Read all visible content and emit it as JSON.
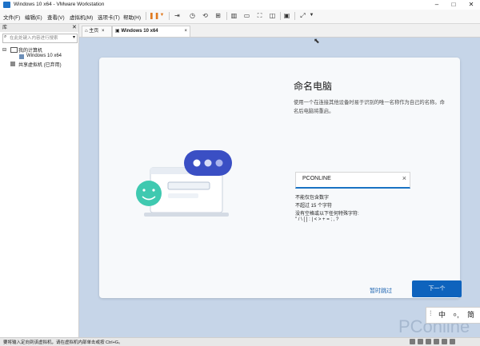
{
  "window": {
    "title": "Windows 10 x64 - VMware Workstation"
  },
  "menu": [
    "文件(F)",
    "编辑(E)",
    "查看(V)",
    "虚拟机(M)",
    "选项卡(T)",
    "帮助(H)"
  ],
  "sidebar": {
    "header": "库",
    "search_placeholder": "在此处键入内容进行搜索",
    "tree": [
      {
        "label": "我的计算机"
      },
      {
        "label": "Windows 10 x64"
      },
      {
        "label": "共享虚拟机 (已弃用)"
      }
    ]
  },
  "tabs": [
    {
      "label": "主页"
    },
    {
      "label": "Windows 10 x64"
    }
  ],
  "setup": {
    "heading": "命名电脑",
    "description": "使用一个在连接其他设备时易于识别的唯一名称作为自己的名称。命名后电脑将重启。",
    "input_value": "PCONLINE",
    "rules": [
      "不能仅包含数字",
      "不超过 15 个字符",
      "没有空格或以下任何特殊字符:",
      "\" / \\ [ ] : | < > + = ; , ?"
    ],
    "skip_label": "暂时跳过",
    "next_label": "下一个"
  },
  "ime": {
    "mode": "中",
    "script": "简"
  },
  "watermark": "PConline",
  "status": {
    "text": "要将输入定向到该虚拟机，请在虚拟机内部单击或按 Ctrl+G。"
  },
  "colors": {
    "accent": "#0e63bd",
    "vm_background": "#c6d5e8",
    "pause_icon": "#e07a1f"
  }
}
